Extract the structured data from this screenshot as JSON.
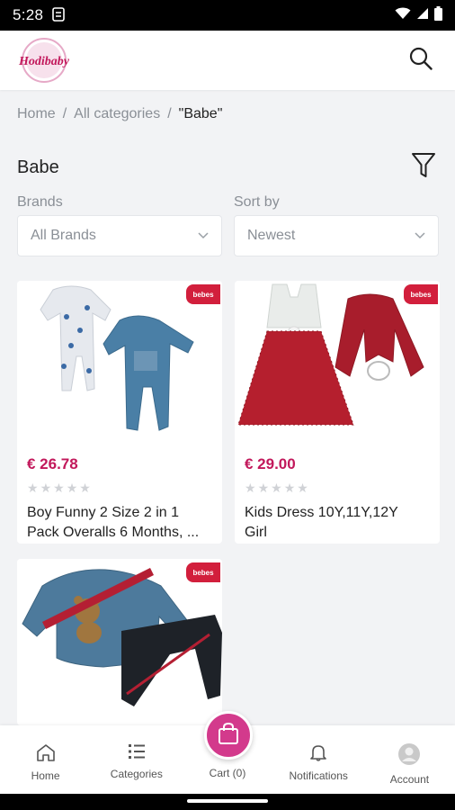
{
  "status_bar": {
    "time": "5:28"
  },
  "app": {
    "logo_text": "Hodibaby",
    "brand_color": "#c2185b"
  },
  "breadcrumb": {
    "home": "Home",
    "sep1": "/",
    "all": "All categories",
    "sep2": "/",
    "current": "\"Babe\""
  },
  "page": {
    "title": "Babe"
  },
  "filters": {
    "brands_label": "Brands",
    "brands_value": "All Brands",
    "sort_label": "Sort by",
    "sort_value": "Newest"
  },
  "products": [
    {
      "price": "€ 26.78",
      "name_line1": "Boy Funny 2 Size 2 in 1",
      "name_line2": "Pack Overalls 6 Months, ...",
      "rating": 0,
      "badge": "bebes"
    },
    {
      "price": "€ 29.00",
      "name_line1": "Kids Dress 10Y,11Y,12Y",
      "name_line2": "Girl",
      "rating": 0,
      "badge": "bebes"
    },
    {
      "badge": "bebes"
    }
  ],
  "bottom_nav": {
    "home": "Home",
    "categories": "Categories",
    "cart": "Cart (0)",
    "notifications": "Notifications",
    "account": "Account"
  }
}
